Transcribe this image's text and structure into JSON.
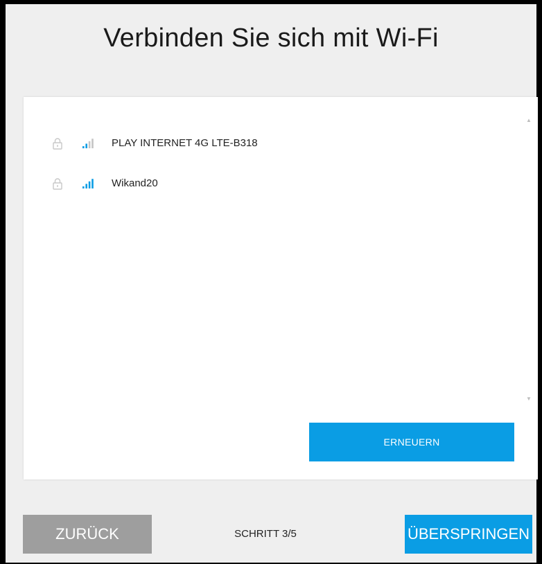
{
  "page": {
    "title": "Verbinden Sie sich mit Wi-Fi"
  },
  "networks": [
    {
      "name": "PLAY INTERNET 4G LTE-B318",
      "secured": true,
      "signal_bars": 2,
      "signal_total": 4
    },
    {
      "name": "Wikand20",
      "secured": true,
      "signal_bars": 4,
      "signal_total": 4
    }
  ],
  "refresh_button": {
    "label": "ERNEUERN"
  },
  "footer": {
    "back_label": "ZURÜCK",
    "step_label": "SCHRITT 3/5",
    "skip_label": "ÜBERSPRINGEN"
  },
  "colors": {
    "accent": "#0a9de4",
    "disabled": "#9e9e9e",
    "background": "#efefef",
    "signal_inactive": "#c4c4c4"
  },
  "icons": {
    "lock": "lock-icon",
    "signal": "wifi-signal-icon"
  }
}
